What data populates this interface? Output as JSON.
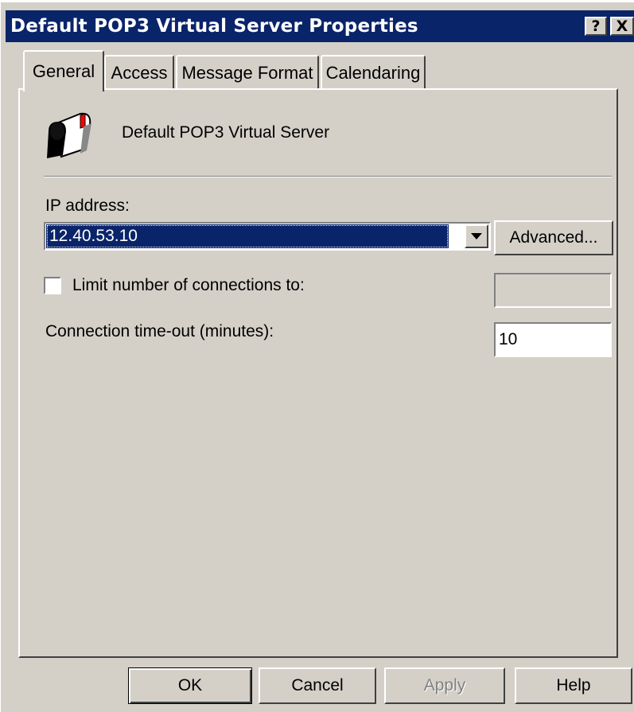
{
  "window": {
    "title": "Default POP3 Virtual Server Properties",
    "help_glyph": "?",
    "close_glyph": "X"
  },
  "tabs": [
    {
      "label": "General",
      "active": true
    },
    {
      "label": "Access",
      "active": false
    },
    {
      "label": "Message Format",
      "active": false
    },
    {
      "label": "Calendaring",
      "active": false
    }
  ],
  "general": {
    "server_icon": "mailbox-icon",
    "server_name": "Default POP3 Virtual Server",
    "ip_label": "IP address:",
    "ip_value": "12.40.53.10",
    "advanced_label": "Advanced...",
    "limit_label": "Limit number of connections to:",
    "limit_checked": false,
    "limit_value": "",
    "timeout_label": "Connection time-out (minutes):",
    "timeout_value": "10"
  },
  "buttons": {
    "ok": "OK",
    "cancel": "Cancel",
    "apply": "Apply",
    "help": "Help"
  },
  "colors": {
    "titlebar": "#0a246a",
    "face": "#d4d0c8",
    "selection": "#0a246a"
  }
}
